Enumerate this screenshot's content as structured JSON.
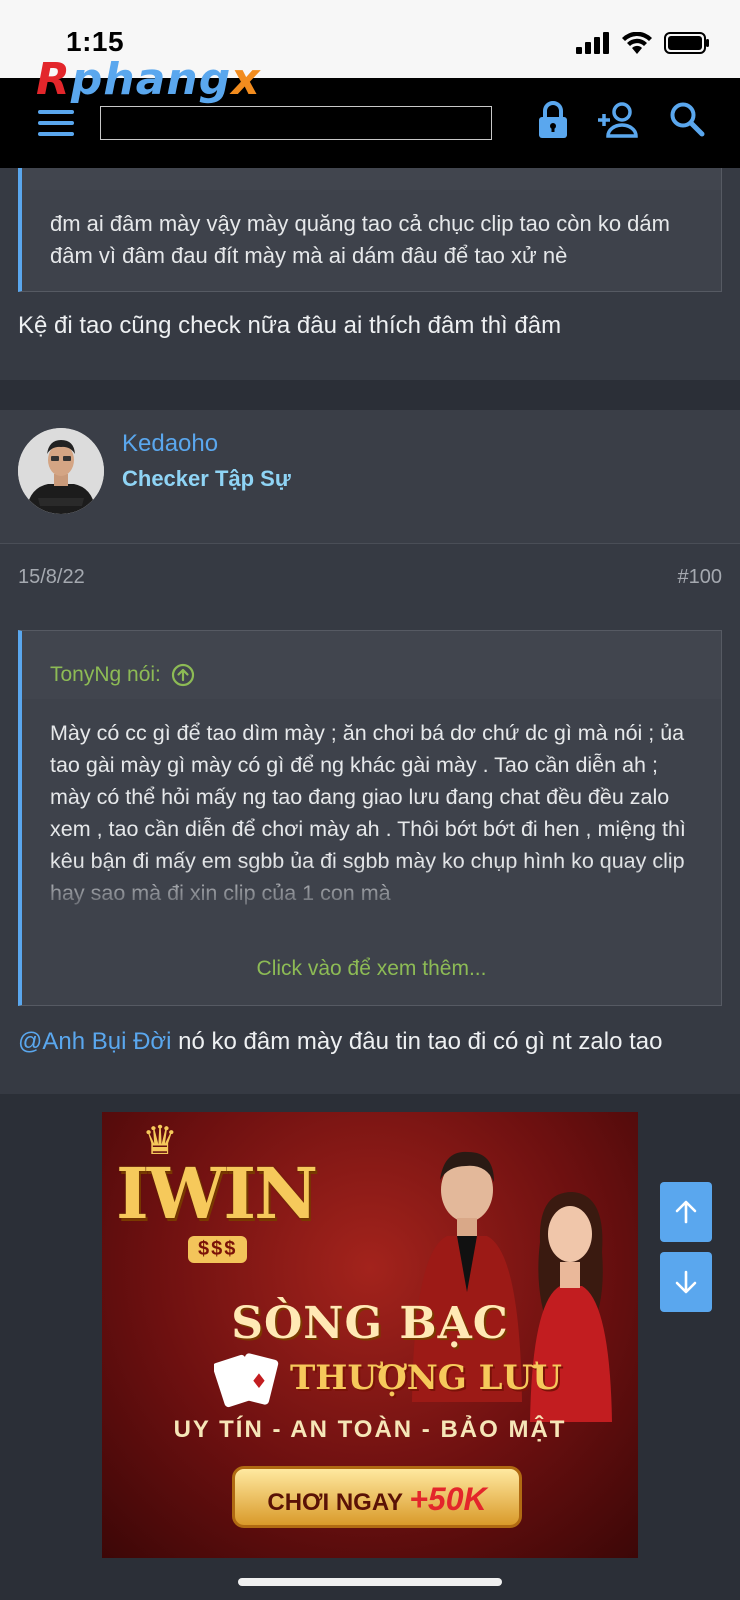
{
  "status_bar": {
    "time": "1:15"
  },
  "site": {
    "logo_part1": "R",
    "logo_part2": "phang",
    "logo_part3": "x",
    "search_value": ""
  },
  "colors": {
    "accent": "#5aa7ee",
    "navbar_bg": "#000000",
    "page_bg": "#2b2f37",
    "post_bg": "#363a43",
    "quote_green": "#8dbb55",
    "user_title": "#8fd4f5"
  },
  "icons": {
    "menu": "hamburger-menu-icon",
    "login": "lock-icon",
    "register": "add-user-icon",
    "search": "search-icon",
    "scroll_up": "arrow-up-icon",
    "scroll_down": "arrow-down-icon",
    "quote_jump": "circle-arrow-up-icon"
  },
  "post_prev": {
    "quote_text": "đm ai đâm mày vậy mày quăng tao cả chục clip tao còn ko dám đâm vì đâm đau đít mày mà ai dám đâu để tao xử nè",
    "body": "Kệ đi tao cũng check nữa đâu ai thích đâm thì đâm"
  },
  "post": {
    "username": "Kedaoho",
    "user_title": "Checker Tập Sự",
    "date": "15/8/22",
    "number": "#100",
    "quote": {
      "author": "TonyNg nói:",
      "text": "Mày có cc gì để tao dìm mày ; ăn chơi bá dơ chứ dc gì mà nói ; ủa tao gài mày gì mày có gì để ng khác gài mày . Tao cần diễn ah ; mày có thể hỏi mấy ng tao đang giao lưu đang chat đều đều zalo xem , tao cần diễn để chơi mày ah . Thôi bớt bớt đi hen , miệng thì kêu bận đi mấy em sgbb ủa đi sgbb mày ko chụp hình ko quay clip hay sao mà đi xin clip của 1 con mà",
      "expand_label": "Click vào để xem thêm..."
    },
    "mention": "@Anh Bụi Đời",
    "body": " nó ko đâm mày đâu tin tao đi có gì nt zalo tao"
  },
  "ad": {
    "brand": "IWIN",
    "sub": "$$$",
    "line1": "SÒNG BẠC",
    "line2": "THƯỢNG LƯU",
    "line3": "UY TÍN - AN TOÀN - BẢO MẬT",
    "cta": "CHƠI NGAY",
    "bonus": "+50K"
  }
}
